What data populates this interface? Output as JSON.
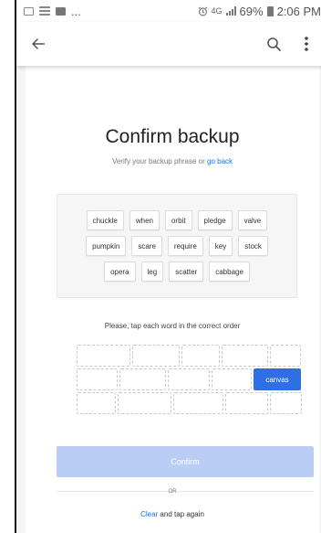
{
  "status_bar": {
    "left_icons": [
      "image-icon",
      "list-icon",
      "video-icon"
    ],
    "ellipsis": "...",
    "network": "4G",
    "battery": "69%",
    "time": "2:06 PM"
  },
  "app_bar": {
    "back_icon": "arrow-left-icon",
    "search_icon": "search-icon",
    "menu_icon": "more-vert-icon"
  },
  "main": {
    "title": "Confirm backup",
    "subtitle_prefix": "Verify your backup phrase or",
    "subtitle_link": "go back",
    "word_rows": [
      [
        "chuckle",
        "when",
        "orbit",
        "pledge",
        "valve"
      ],
      [
        "pumpkin",
        "scare",
        "require",
        "key",
        "stock"
      ],
      [
        "opera",
        "leg",
        "scatter",
        "cabbage"
      ]
    ],
    "instruction": "Please, tap each word in the correct order",
    "selected_words": [
      "canvas"
    ],
    "confirm_label": "Confirm",
    "or_label": "OR",
    "clear_link": "Clear",
    "clear_suffix": "and tap again"
  },
  "colors": {
    "accent": "#2f6fe4",
    "link": "#1a73e8",
    "confirm_disabled": "#b9cdf5"
  }
}
